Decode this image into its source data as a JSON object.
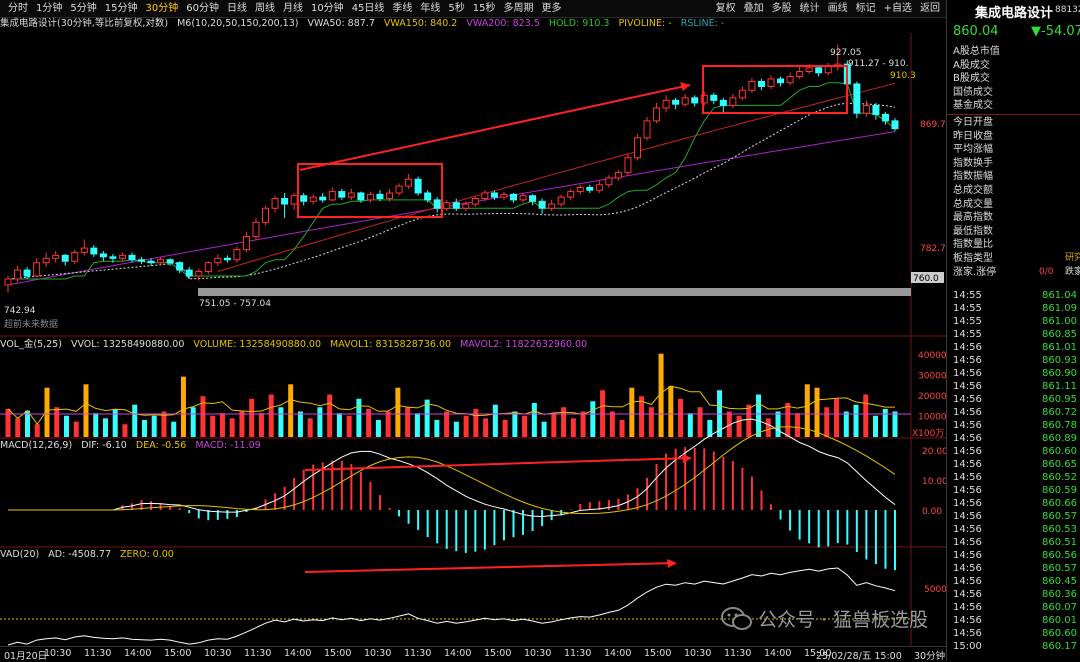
{
  "header": {
    "periods": [
      "分时",
      "1分钟",
      "5分钟",
      "15分钟",
      "30分钟",
      "60分钟",
      "日线",
      "周线",
      "月线",
      "10分钟",
      "45日线",
      "季线",
      "年线",
      "5秒",
      "15秒",
      "多周期",
      "更多"
    ],
    "active_period": "30分钟",
    "tools": [
      "复权",
      "叠加",
      "多股",
      "统计",
      "画线",
      "标记",
      "+自选",
      "返回"
    ]
  },
  "main_legend": {
    "title": "集成电路设计(30分钟,等比前复权,对数)",
    "ma": "M6(10,20,50,150,200,13)",
    "vwa50": "VWA50: 887.7",
    "vwa150": "VWA150: 840.2",
    "vwa200": "VWA200: 823.5",
    "hold": "HOLD: 910.3",
    "pivoline": "PIVOLINE: -",
    "rsline": "RSLINE: -"
  },
  "price_axis": {
    "high": "927.05",
    "top_label": "911.27 - 910.",
    "hold_label": "910.3",
    "mid": "869.7",
    "low_axis": "782.7",
    "support": "760.0",
    "range_label": "751.05 - 757.04",
    "bottom_low": "742.94"
  },
  "candles": [
    {
      "o": 748,
      "c": 752,
      "h": 754,
      "l": 743
    },
    {
      "o": 752,
      "c": 758,
      "h": 761,
      "l": 750
    },
    {
      "o": 758,
      "c": 754,
      "h": 760,
      "l": 752
    },
    {
      "o": 754,
      "c": 763,
      "h": 766,
      "l": 753
    },
    {
      "o": 763,
      "c": 766,
      "h": 770,
      "l": 760
    },
    {
      "o": 766,
      "c": 768,
      "h": 771,
      "l": 763
    },
    {
      "o": 768,
      "c": 764,
      "h": 769,
      "l": 761
    },
    {
      "o": 764,
      "c": 770,
      "h": 772,
      "l": 762
    },
    {
      "o": 770,
      "c": 773,
      "h": 779,
      "l": 768
    },
    {
      "o": 773,
      "c": 769,
      "h": 775,
      "l": 767
    },
    {
      "o": 769,
      "c": 767,
      "h": 771,
      "l": 764
    },
    {
      "o": 767,
      "c": 766,
      "h": 769,
      "l": 763
    },
    {
      "o": 766,
      "c": 768,
      "h": 770,
      "l": 764
    },
    {
      "o": 768,
      "c": 765,
      "h": 770,
      "l": 763
    },
    {
      "o": 765,
      "c": 764,
      "h": 767,
      "l": 762
    },
    {
      "o": 764,
      "c": 763,
      "h": 766,
      "l": 761
    },
    {
      "o": 763,
      "c": 765,
      "h": 767,
      "l": 762
    },
    {
      "o": 765,
      "c": 763,
      "h": 766,
      "l": 761
    },
    {
      "o": 763,
      "c": 758,
      "h": 764,
      "l": 756
    },
    {
      "o": 758,
      "c": 754,
      "h": 760,
      "l": 752
    },
    {
      "o": 754,
      "c": 757,
      "h": 759,
      "l": 751
    },
    {
      "o": 757,
      "c": 763,
      "h": 764,
      "l": 755
    },
    {
      "o": 763,
      "c": 766,
      "h": 769,
      "l": 761
    },
    {
      "o": 766,
      "c": 765,
      "h": 768,
      "l": 763
    },
    {
      "o": 765,
      "c": 772,
      "h": 774,
      "l": 763
    },
    {
      "o": 772,
      "c": 781,
      "h": 784,
      "l": 770
    },
    {
      "o": 781,
      "c": 791,
      "h": 794,
      "l": 779
    },
    {
      "o": 791,
      "c": 801,
      "h": 803,
      "l": 789
    },
    {
      "o": 801,
      "c": 808,
      "h": 810,
      "l": 798
    },
    {
      "o": 808,
      "c": 804,
      "h": 812,
      "l": 794
    },
    {
      "o": 804,
      "c": 810,
      "h": 812,
      "l": 800
    },
    {
      "o": 810,
      "c": 806,
      "h": 812,
      "l": 803
    },
    {
      "o": 806,
      "c": 809,
      "h": 811,
      "l": 804
    },
    {
      "o": 809,
      "c": 807,
      "h": 812,
      "l": 805
    },
    {
      "o": 807,
      "c": 813,
      "h": 816,
      "l": 806
    },
    {
      "o": 813,
      "c": 809,
      "h": 815,
      "l": 807
    },
    {
      "o": 809,
      "c": 812,
      "h": 815,
      "l": 807
    },
    {
      "o": 812,
      "c": 807,
      "h": 813,
      "l": 805
    },
    {
      "o": 807,
      "c": 811,
      "h": 813,
      "l": 805
    },
    {
      "o": 811,
      "c": 808,
      "h": 814,
      "l": 806
    },
    {
      "o": 808,
      "c": 812,
      "h": 815,
      "l": 806
    },
    {
      "o": 812,
      "c": 817,
      "h": 819,
      "l": 810
    },
    {
      "o": 817,
      "c": 822,
      "h": 826,
      "l": 815
    },
    {
      "o": 822,
      "c": 812,
      "h": 824,
      "l": 810
    },
    {
      "o": 812,
      "c": 807,
      "h": 814,
      "l": 805
    },
    {
      "o": 807,
      "c": 801,
      "h": 809,
      "l": 798
    },
    {
      "o": 801,
      "c": 805,
      "h": 807,
      "l": 799
    },
    {
      "o": 805,
      "c": 801,
      "h": 808,
      "l": 799
    },
    {
      "o": 801,
      "c": 804,
      "h": 806,
      "l": 799
    },
    {
      "o": 804,
      "c": 808,
      "h": 810,
      "l": 802
    },
    {
      "o": 808,
      "c": 812,
      "h": 814,
      "l": 806
    },
    {
      "o": 812,
      "c": 809,
      "h": 814,
      "l": 807
    },
    {
      "o": 809,
      "c": 811,
      "h": 813,
      "l": 807
    },
    {
      "o": 811,
      "c": 807,
      "h": 812,
      "l": 805
    },
    {
      "o": 807,
      "c": 810,
      "h": 812,
      "l": 805
    },
    {
      "o": 810,
      "c": 806,
      "h": 811,
      "l": 803
    },
    {
      "o": 806,
      "c": 801,
      "h": 808,
      "l": 797
    },
    {
      "o": 801,
      "c": 804,
      "h": 807,
      "l": 799
    },
    {
      "o": 804,
      "c": 809,
      "h": 811,
      "l": 802
    },
    {
      "o": 809,
      "c": 813,
      "h": 815,
      "l": 807
    },
    {
      "o": 813,
      "c": 816,
      "h": 818,
      "l": 811
    },
    {
      "o": 816,
      "c": 814,
      "h": 818,
      "l": 812
    },
    {
      "o": 814,
      "c": 818,
      "h": 821,
      "l": 812
    },
    {
      "o": 818,
      "c": 823,
      "h": 825,
      "l": 816
    },
    {
      "o": 823,
      "c": 827,
      "h": 829,
      "l": 821
    },
    {
      "o": 827,
      "c": 838,
      "h": 841,
      "l": 825
    },
    {
      "o": 838,
      "c": 853,
      "h": 856,
      "l": 836
    },
    {
      "o": 853,
      "c": 866,
      "h": 869,
      "l": 851
    },
    {
      "o": 866,
      "c": 876,
      "h": 880,
      "l": 864
    },
    {
      "o": 876,
      "c": 882,
      "h": 886,
      "l": 873
    },
    {
      "o": 882,
      "c": 879,
      "h": 884,
      "l": 875
    },
    {
      "o": 879,
      "c": 884,
      "h": 887,
      "l": 877
    },
    {
      "o": 884,
      "c": 880,
      "h": 886,
      "l": 877
    },
    {
      "o": 880,
      "c": 886,
      "h": 889,
      "l": 878
    },
    {
      "o": 886,
      "c": 882,
      "h": 888,
      "l": 879
    },
    {
      "o": 882,
      "c": 878,
      "h": 884,
      "l": 872
    },
    {
      "o": 878,
      "c": 884,
      "h": 887,
      "l": 876
    },
    {
      "o": 884,
      "c": 890,
      "h": 893,
      "l": 882
    },
    {
      "o": 890,
      "c": 897,
      "h": 900,
      "l": 888
    },
    {
      "o": 897,
      "c": 893,
      "h": 899,
      "l": 890
    },
    {
      "o": 893,
      "c": 899,
      "h": 902,
      "l": 891
    },
    {
      "o": 899,
      "c": 896,
      "h": 901,
      "l": 893
    },
    {
      "o": 896,
      "c": 901,
      "h": 904,
      "l": 894
    },
    {
      "o": 901,
      "c": 905,
      "h": 909,
      "l": 899
    },
    {
      "o": 905,
      "c": 908,
      "h": 911,
      "l": 903
    },
    {
      "o": 908,
      "c": 904,
      "h": 910,
      "l": 901
    },
    {
      "o": 904,
      "c": 909,
      "h": 912,
      "l": 902
    },
    {
      "o": 909,
      "c": 911,
      "h": 927,
      "l": 906
    },
    {
      "o": 911,
      "c": 895,
      "h": 914,
      "l": 880
    },
    {
      "o": 895,
      "c": 872,
      "h": 897,
      "l": 868
    },
    {
      "o": 872,
      "c": 878,
      "h": 882,
      "l": 869
    },
    {
      "o": 878,
      "c": 871,
      "h": 880,
      "l": 867
    },
    {
      "o": 871,
      "c": 866,
      "h": 873,
      "l": 863
    },
    {
      "o": 866,
      "c": 860,
      "h": 868,
      "l": 858
    }
  ],
  "volume_legend": {
    "name": "VOL_金(5,25)",
    "vvol": "VVOL: 13258490880.00",
    "volume": "VOLUME: 13258490880.00",
    "mavol1": "MAVOL1: 8315828736.00",
    "mavol2": "MAVOL2: 11822632960.00",
    "axis": [
      "40000",
      "30000",
      "20000",
      "10000"
    ],
    "unit": "X100万"
  },
  "volumes": [
    0.33,
    0.22,
    0.31,
    0.15,
    0.58,
    0.35,
    0.25,
    0.18,
    0.62,
    0.28,
    0.22,
    0.33,
    0.15,
    0.38,
    0.2,
    0.25,
    0.3,
    0.18,
    0.71,
    0.35,
    0.48,
    0.25,
    0.28,
    0.22,
    0.3,
    0.45,
    0.28,
    0.5,
    0.35,
    0.62,
    0.3,
    0.22,
    0.35,
    0.5,
    0.28,
    0.25,
    0.45,
    0.33,
    0.2,
    0.3,
    0.58,
    0.35,
    0.28,
    0.44,
    0.2,
    0.3,
    0.18,
    0.25,
    0.33,
    0.22,
    0.38,
    0.2,
    0.3,
    0.25,
    0.4,
    0.18,
    0.28,
    0.35,
    0.22,
    0.3,
    0.42,
    0.55,
    0.3,
    0.2,
    0.58,
    0.48,
    0.35,
    0.98,
    0.6,
    0.45,
    0.28,
    0.35,
    0.2,
    0.55,
    0.3,
    0.25,
    0.38,
    0.5,
    0.22,
    0.3,
    0.4,
    0.28,
    0.62,
    0.58,
    0.35,
    0.45,
    0.3,
    0.38,
    0.5,
    0.25,
    0.33,
    0.3
  ],
  "macd_legend": {
    "name": "MACD(12,26,9)",
    "dif": "DIF: -6.10",
    "dea": "DEA: -0.56",
    "macd": "MACD: -11.09",
    "axis": [
      "20.00",
      "10.00",
      "0.00"
    ]
  },
  "vad_legend": {
    "name": "VAD(20)",
    "ad": "AD: -4508.77",
    "zero": "ZERO: 0.00",
    "axis": [
      "5000"
    ]
  },
  "x_axis": [
    "01月20日",
    "10:30",
    "11:30",
    "14:00",
    "15:00",
    "10:30",
    "11:30",
    "14:00",
    "15:00",
    "10:30",
    "11:30",
    "14:00",
    "15:00",
    "10:30",
    "11:30",
    "14:00",
    "15:00",
    "10:30",
    "11:30",
    "14:00",
    "15:00",
    "25/02/28/五 15:00",
    "30分钟"
  ],
  "misc": {
    "future_label": "超前未来数据"
  },
  "quote": {
    "name": "集成电路设计",
    "code": "88132",
    "price": "860.04",
    "change": "▼-54.07",
    "fields": [
      "A股总市值",
      "A股成交",
      "B股成交",
      "国债成交",
      "基金成交",
      "今日开盘",
      "昨日收盘",
      "平均涨幅",
      "指数换手",
      "指数振幅",
      "总成交额",
      "总成交量",
      "最高指数",
      "最低指数",
      "指数量比",
      "板指类型",
      "涨家.涨停"
    ],
    "field_value_type": "研究",
    "field_value_up": "0/0",
    "field_value_fall": "跌家"
  },
  "ticks": [
    {
      "t": "14:55",
      "p": "861.04"
    },
    {
      "t": "14:55",
      "p": "861.09"
    },
    {
      "t": "14:55",
      "p": "861.00"
    },
    {
      "t": "14:55",
      "p": "860.85"
    },
    {
      "t": "14:56",
      "p": "861.01"
    },
    {
      "t": "14:56",
      "p": "860.93"
    },
    {
      "t": "14:56",
      "p": "860.90"
    },
    {
      "t": "14:56",
      "p": "861.11"
    },
    {
      "t": "14:56",
      "p": "860.95"
    },
    {
      "t": "14:56",
      "p": "860.72"
    },
    {
      "t": "14:56",
      "p": "860.78"
    },
    {
      "t": "14:56",
      "p": "860.89"
    },
    {
      "t": "14:56",
      "p": "860.60"
    },
    {
      "t": "14:56",
      "p": "860.65"
    },
    {
      "t": "14:56",
      "p": "860.52"
    },
    {
      "t": "14:56",
      "p": "860.59"
    },
    {
      "t": "14:56",
      "p": "860.66"
    },
    {
      "t": "14:56",
      "p": "860.57"
    },
    {
      "t": "14:56",
      "p": "860.53"
    },
    {
      "t": "14:56",
      "p": "860.51"
    },
    {
      "t": "14:56",
      "p": "860.56"
    },
    {
      "t": "14:56",
      "p": "860.57"
    },
    {
      "t": "14:56",
      "p": "860.45"
    },
    {
      "t": "14:56",
      "p": "860.36"
    },
    {
      "t": "14:56",
      "p": "860.07"
    },
    {
      "t": "14:56",
      "p": "860.01"
    },
    {
      "t": "14:56",
      "p": "860.60"
    },
    {
      "t": "15:00",
      "p": "860.17"
    }
  ],
  "watermark": "公众号 · 猛兽板选股",
  "colors": {
    "up": "#ff3333",
    "down": "#33ffff",
    "vol_orange": "#ffaa00",
    "box": "#ff2222",
    "ma_green": "#22aa22",
    "ma_white": "#dddddd",
    "ma_purple": "#aa22cc",
    "ma_red": "#cc2222"
  }
}
